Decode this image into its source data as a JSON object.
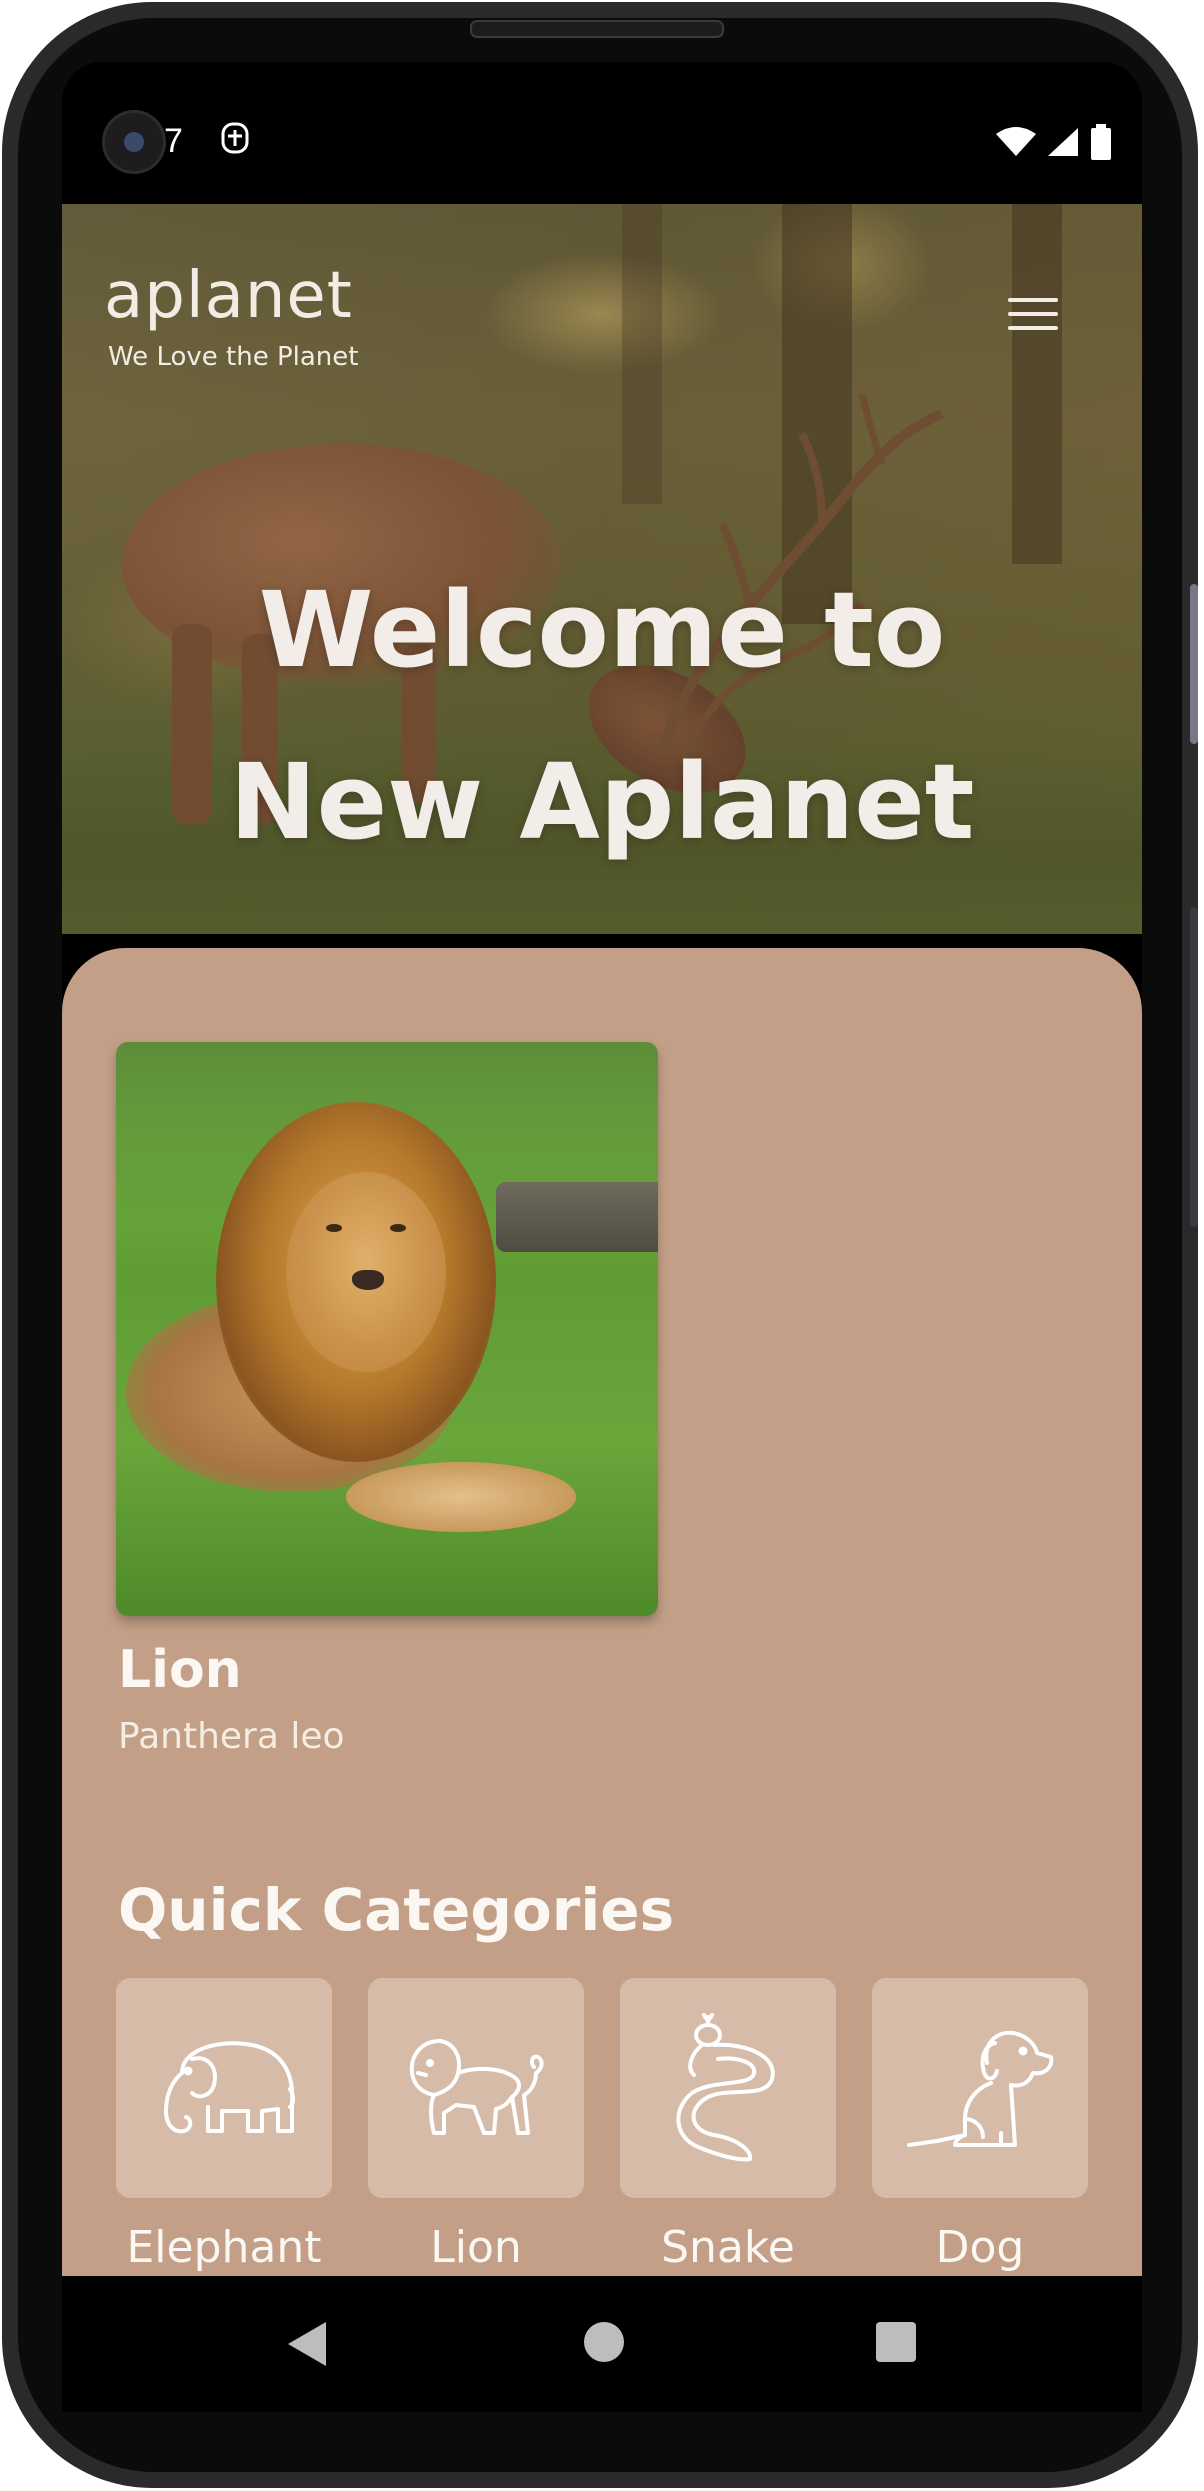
{
  "status_bar": {
    "time": "7",
    "icons": [
      "camera-cutout",
      "app-notification-icon",
      "wifi-icon",
      "cellular-signal-icon",
      "battery-icon"
    ]
  },
  "header": {
    "logo": "aplanet",
    "tagline": "We Love the Planet",
    "menu_icon": "hamburger-menu-icon"
  },
  "hero": {
    "title_line1": "Welcome to",
    "title_line2": "New Aplanet"
  },
  "featured_animal": {
    "name": "Lion",
    "scientific_name": "Panthera leo"
  },
  "quick_categories": {
    "title": "Quick Categories",
    "items": [
      {
        "label": "Elephant",
        "icon": "elephant-icon"
      },
      {
        "label": "Lion",
        "icon": "lion-icon"
      },
      {
        "label": "Snake",
        "icon": "snake-icon"
      },
      {
        "label": "Dog",
        "icon": "dog-icon"
      }
    ]
  },
  "nav_bar": {
    "buttons": [
      "back",
      "home",
      "recents"
    ]
  },
  "colors": {
    "sheet": "#c29f86",
    "tile": "#d6bba8",
    "text_light": "#fbf7f3"
  }
}
